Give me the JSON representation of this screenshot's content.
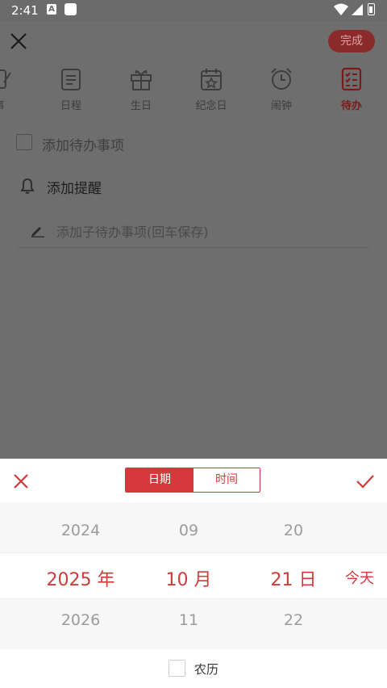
{
  "status_bar": {
    "time": "2:41",
    "notification_letter": "A"
  },
  "editor": {
    "done_label": "完成",
    "categories": [
      {
        "label": "事",
        "icon": "pen-note-icon"
      },
      {
        "label": "日程",
        "icon": "schedule-icon"
      },
      {
        "label": "生日",
        "icon": "gift-icon"
      },
      {
        "label": "纪念日",
        "icon": "calendar-star-icon"
      },
      {
        "label": "闹钟",
        "icon": "alarm-clock-icon"
      },
      {
        "label": "待办",
        "icon": "checklist-icon",
        "active": true
      }
    ],
    "todo_placeholder": "添加待办事项",
    "reminder_label": "添加提醒",
    "subtask_placeholder": "添加子待办事项(回车保存)"
  },
  "picker": {
    "tabs": {
      "date": "日期",
      "time": "时间",
      "selected": "日期"
    },
    "year": {
      "prev": "2024",
      "selected": "2025 年",
      "next": "2026"
    },
    "month": {
      "prev": "09",
      "selected": "10 月",
      "next": "11"
    },
    "day": {
      "prev": "20",
      "selected": "21 日",
      "next": "22"
    },
    "today_label": "今天",
    "lunar_label": "农历",
    "lunar_checked": false
  },
  "colors": {
    "accent": "#d6393b",
    "overlay": "#6e6e6e",
    "muted_text": "#9b9b9b"
  }
}
